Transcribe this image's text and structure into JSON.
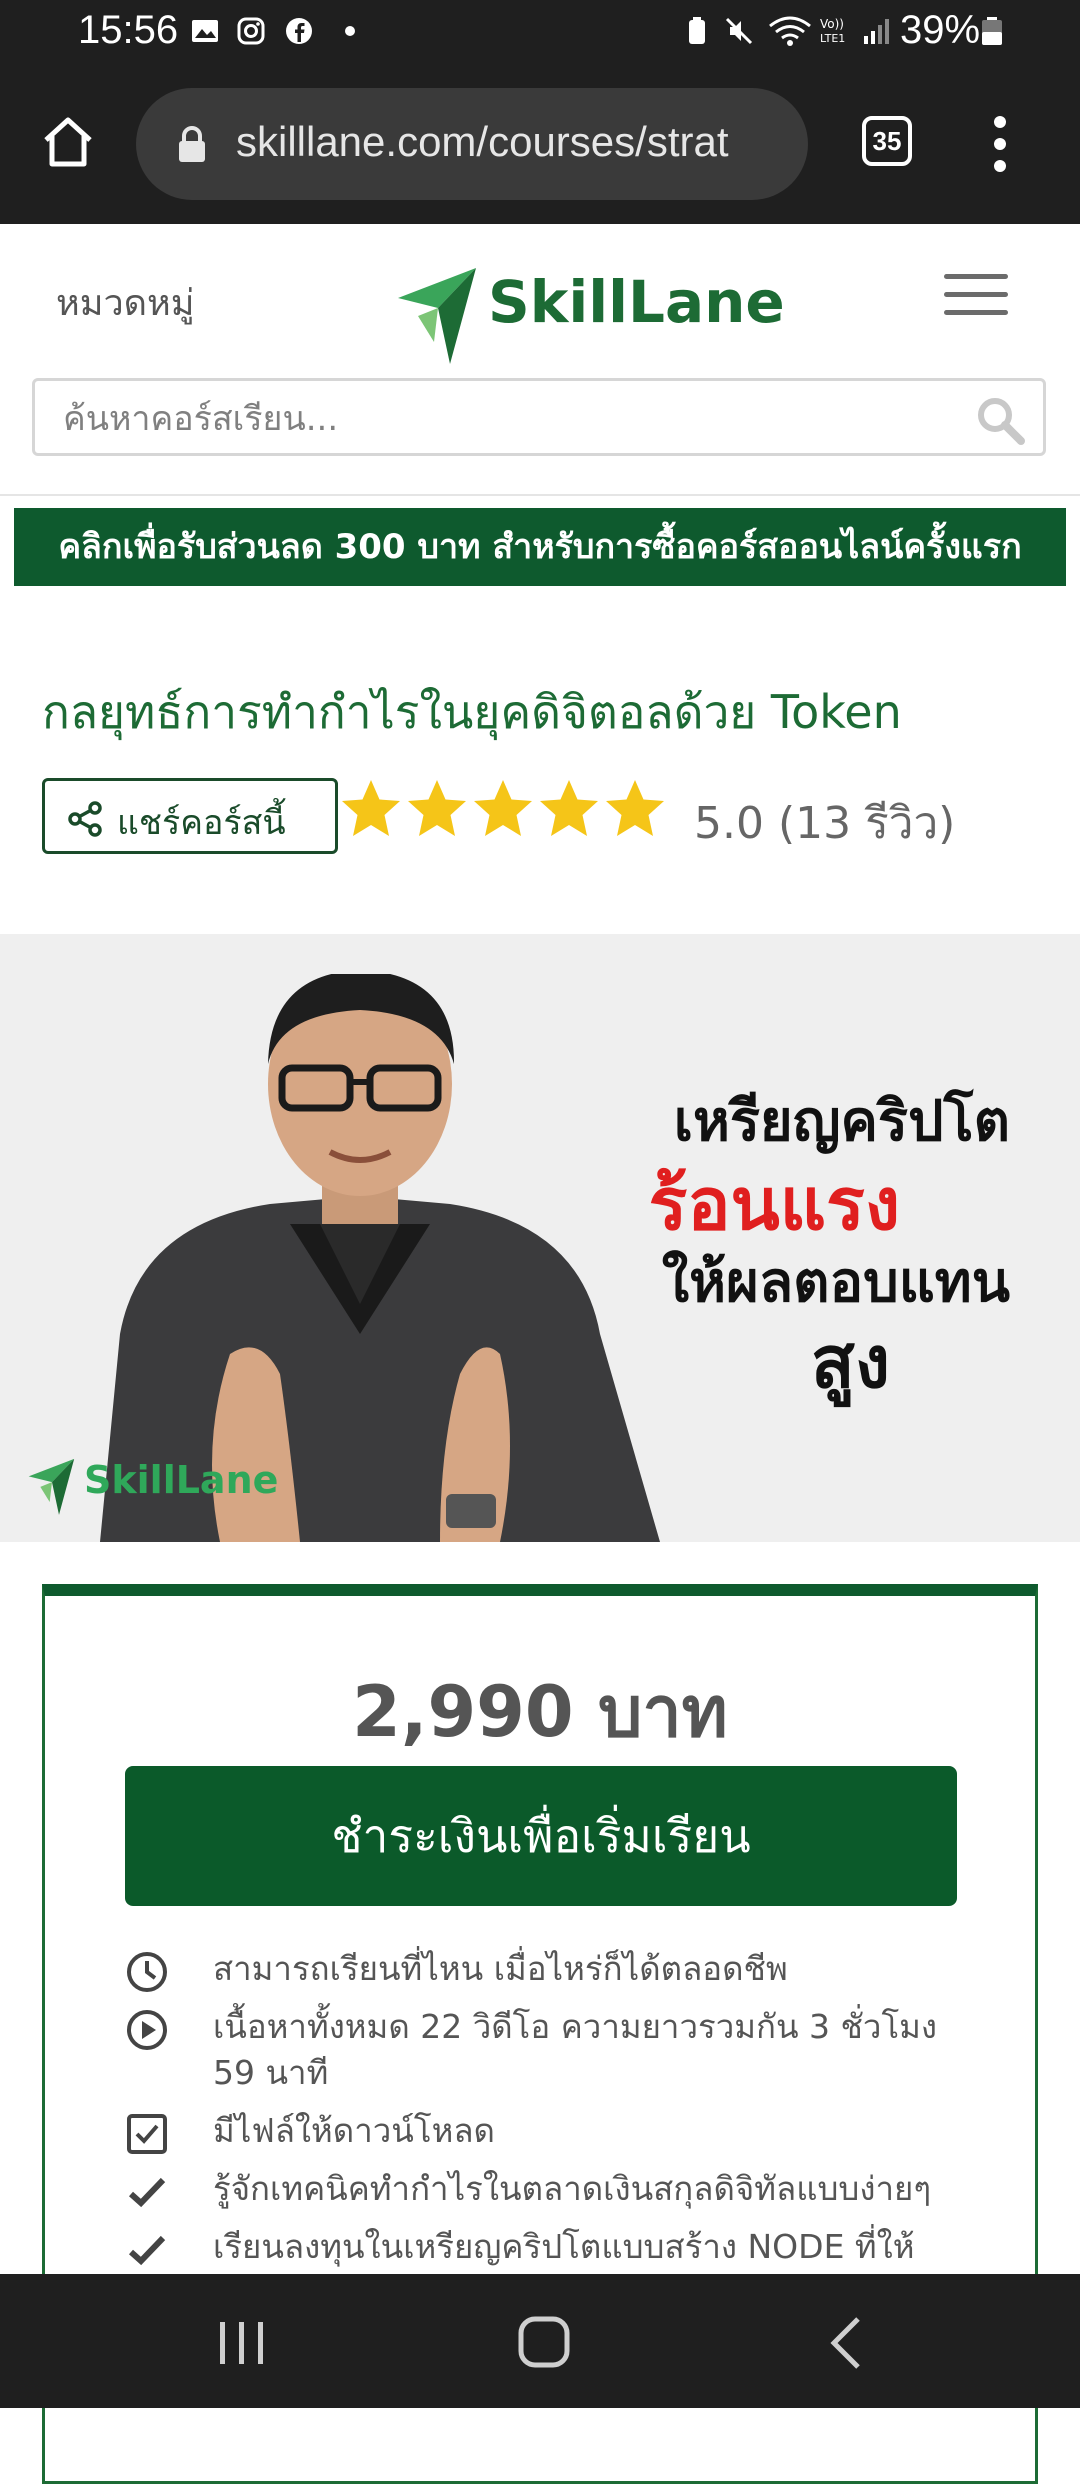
{
  "status_bar": {
    "time": "15:56",
    "battery": "39%"
  },
  "browser": {
    "url": "skilllane.com/courses/strat",
    "tab_count": "35"
  },
  "header": {
    "categories_label": "หมวดหมู่",
    "logo_text": "SkillLane",
    "search_placeholder": "ค้นหาคอร์สเรียน..."
  },
  "promo": {
    "text": "คลิกเพื่อรับส่วนลด 300 บาท สำหรับการซื้อคอร์สออนไลน์ครั้งแรก"
  },
  "course": {
    "title": "กลยุทธ์การทำกำไรในยุคดิจิตอลด้วย  Token",
    "share_label": "แชร์คอร์สนี้",
    "rating": 5,
    "rating_text": "5.0  (13  รีวิว)"
  },
  "video": {
    "line1": "เหรียญคริปโต",
    "line2": "ร้อนแรง",
    "line3": "ให้ผลตอบแทน",
    "line4": "สูง",
    "logo_text": "SkillLane"
  },
  "pricing": {
    "price": "2,990  บาท",
    "pay_button": "ชำระเงินเพื่อเริ่มเรียน",
    "features": [
      {
        "icon": "clock-icon",
        "text": "สามารถเรียนที่ไหน  เมื่อไหร่ก็ได้ตลอดชีพ"
      },
      {
        "icon": "play-circle-icon",
        "text": "เนื้อหาทั้งหมด  22  วิดีโอ  ความยาวรวมกัน  3  ชั่วโมง  59  นาที"
      },
      {
        "icon": "checkbox-icon",
        "text": "มีไฟล์ให้ดาวน์โหลด"
      },
      {
        "icon": "check-icon",
        "text": "รู้จักเทคนิคทำกำไรในตลาดเงินสกุลดิจิทัลแบบง่ายๆ"
      },
      {
        "icon": "check-icon",
        "text": "เรียนลงทุนในเหรียญคริปโตแบบสร้าง  NODE  ที่ให้"
      }
    ]
  },
  "colors": {
    "brand_green": "#0e5a2e",
    "star": "#f5c518",
    "accent_red": "#e01f1f"
  }
}
